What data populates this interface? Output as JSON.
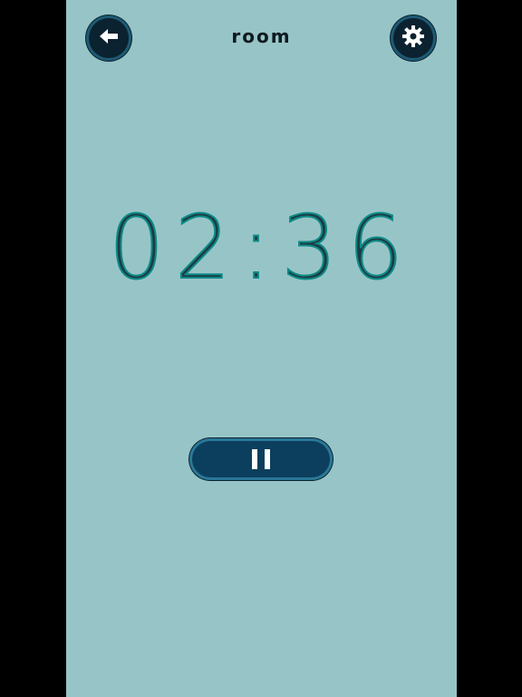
{
  "header": {
    "title": "room",
    "back_icon": "arrow-left-icon",
    "settings_icon": "gear-icon"
  },
  "timer": {
    "display": "02:36"
  },
  "controls": {
    "pause_icon": "pause-icon"
  },
  "colors": {
    "background": "#97c5c7",
    "button_dark": "#0b2230",
    "button_blue": "#0c3f5d",
    "timer_text": "#1c3b44"
  }
}
